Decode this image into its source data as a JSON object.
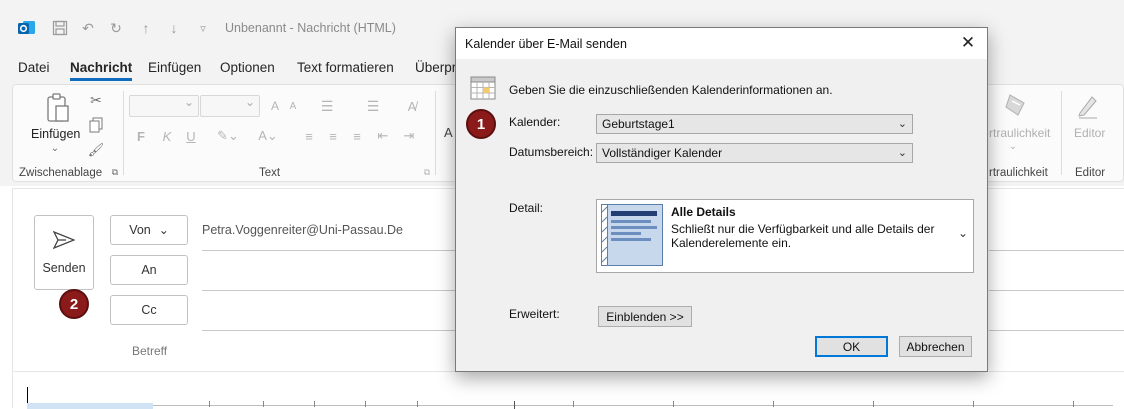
{
  "window": {
    "title": "Unbenannt  -  Nachricht (HTML)"
  },
  "menu": {
    "tabs": [
      "Datei",
      "Nachricht",
      "Einfügen",
      "Optionen",
      "Text formatieren",
      "Überpr"
    ],
    "active": "Nachricht"
  },
  "ribbon": {
    "paste_label": "Einfügen",
    "groups": {
      "clipboard": "Zwischenablage",
      "text": "Text",
      "confidential": "rtraulichkeit",
      "editor": "Editor"
    },
    "confidential_button": "rtraulichkeit",
    "editor_button": "Editor",
    "partial_a": "A"
  },
  "compose": {
    "send_label": "Senden",
    "from_label": "Von",
    "from_value": "Petra.Voggenreiter@Uni-Passau.De",
    "to_label": "An",
    "cc_label": "Cc",
    "subject_label": "Betreff"
  },
  "badges": {
    "one": "1",
    "two": "2"
  },
  "dialog": {
    "title": "Kalender über E-Mail senden",
    "instruction": "Geben Sie die einzuschließenden Kalenderinformationen an.",
    "calendar_label": "Kalender:",
    "calendar_value": "Geburtstage1",
    "range_label": "Datumsbereich:",
    "range_value": "Vollständiger Kalender",
    "detail_label": "Detail:",
    "detail_title": "Alle Details",
    "detail_desc_line1": "Schließt nur die Verfügbarkeit und alle Details der",
    "detail_desc_line2": "Kalenderelemente ein.",
    "advanced_label": "Erweitert:",
    "show_button": "Einblenden >>",
    "ok_button": "OK",
    "cancel_button": "Abbrechen"
  },
  "colors": {
    "accent": "#0f6cbd",
    "badge": "#8b1a1a",
    "dialog_bg": "#f0f0f0"
  }
}
